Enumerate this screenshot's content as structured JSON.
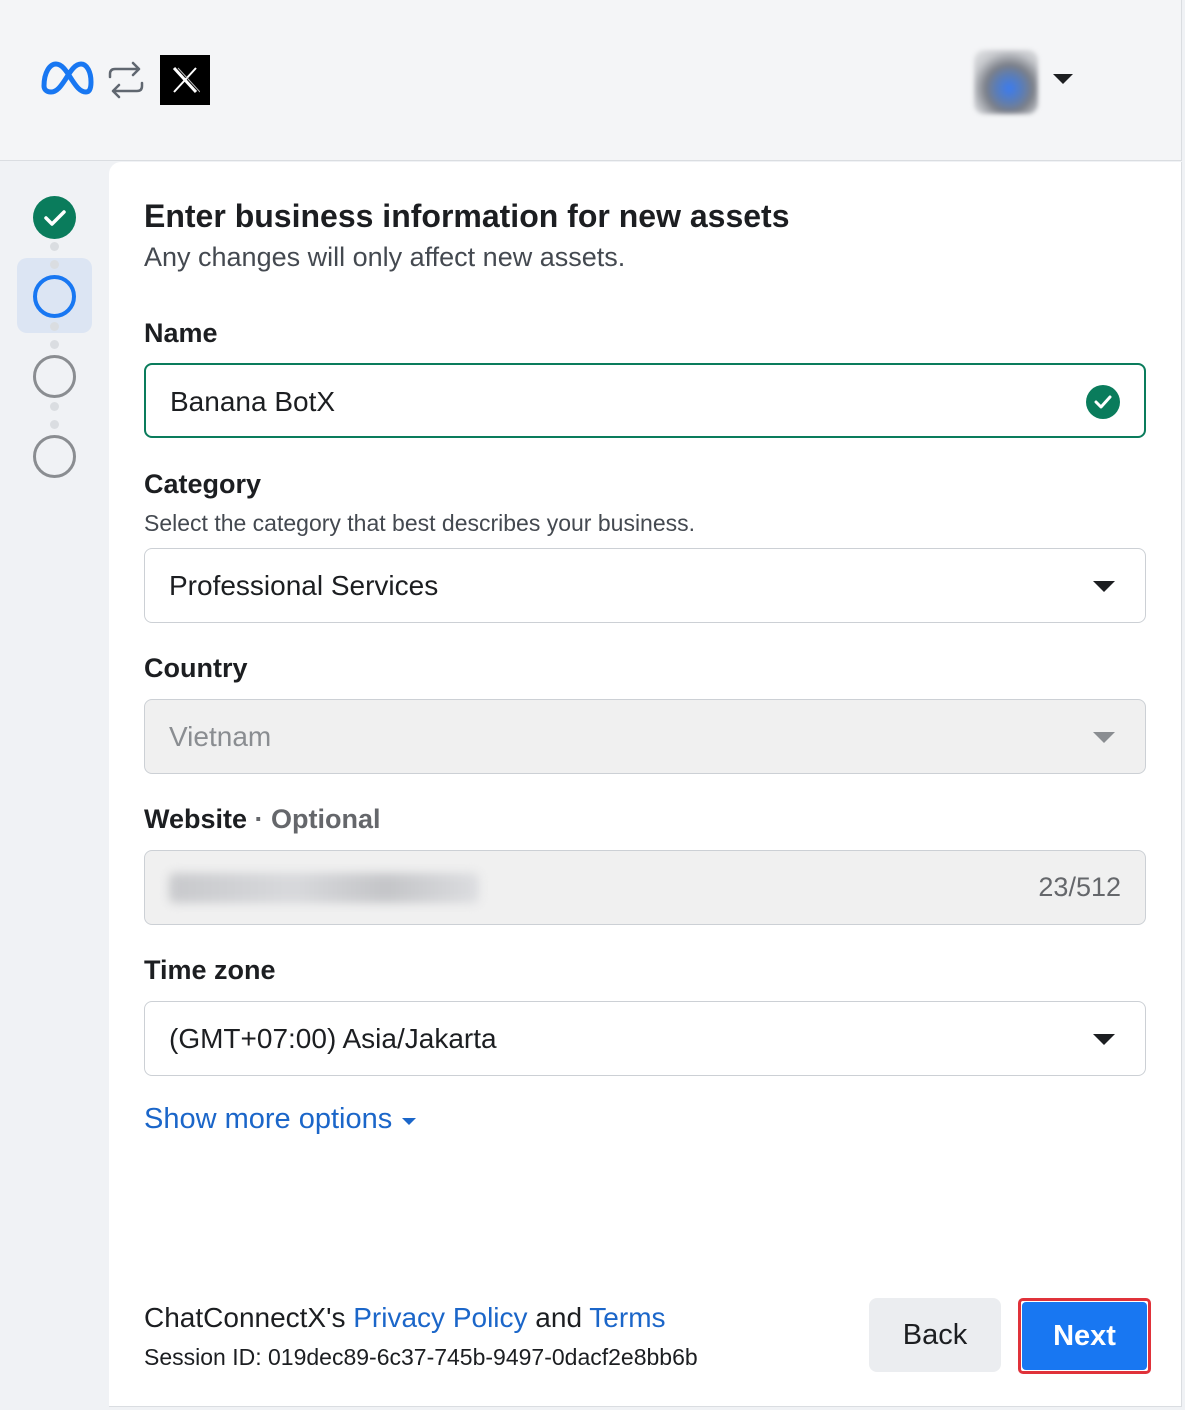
{
  "header": {
    "meta_logo_icon": "meta-logo",
    "sync_icon": "sync-arrows",
    "app_logo_icon": "x-logo",
    "avatar_icon": "user-avatar"
  },
  "stepper": {
    "steps": [
      {
        "state": "done"
      },
      {
        "state": "active"
      },
      {
        "state": "todo"
      },
      {
        "state": "todo"
      }
    ]
  },
  "form": {
    "title": "Enter business information for new assets",
    "subtitle": "Any changes will only affect new assets.",
    "name_label": "Name",
    "name_value": "Banana BotX",
    "category_label": "Category",
    "category_helper": "Select the category that best describes your business.",
    "category_value": "Professional Services",
    "country_label": "Country",
    "country_value": "Vietnam",
    "website_label": "Website",
    "website_optional": "· Optional",
    "website_counter": "23/512",
    "timezone_label": "Time zone",
    "timezone_value": "(GMT+07:00) Asia/Jakarta",
    "show_more": "Show more options"
  },
  "footer": {
    "brand_prefix": "ChatConnectX's",
    "privacy_link": "Privacy Policy",
    "and_text": "and",
    "terms_link": "Terms",
    "session_id": "Session ID: 019dec89-6c37-745b-9497-0dacf2e8bb6b",
    "back_label": "Back",
    "next_label": "Next"
  },
  "colors": {
    "primary": "#1877f2",
    "success": "#0a7c5c",
    "link": "#1b66c9",
    "highlight": "#e0323a"
  }
}
